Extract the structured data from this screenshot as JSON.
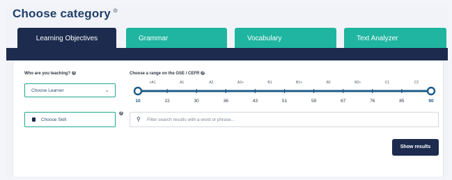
{
  "title": "Choose category",
  "tabs": [
    {
      "label": "Learning Objectives",
      "active": true
    },
    {
      "label": "Grammar",
      "active": false
    },
    {
      "label": "Vocabulary",
      "active": false
    },
    {
      "label": "Text Analyzer",
      "active": false
    }
  ],
  "learner": {
    "label": "Who are you teaching?",
    "select_value": "Choose Learner"
  },
  "range": {
    "label": "Choose a range on the GSE / CEFR",
    "cefr_labels": [
      "<A1",
      "A1",
      "A2",
      "A2+",
      "B1",
      "B1+",
      "B2",
      "B2+",
      "C1",
      "C2"
    ],
    "gse_values": [
      "10",
      "22",
      "30",
      "36",
      "43",
      "51",
      "59",
      "67",
      "76",
      "85",
      "90"
    ],
    "selected_min": 10,
    "selected_max": 90
  },
  "skill": {
    "label": "Choose Skill"
  },
  "search": {
    "placeholder": "Filter search results with a word or phrase..."
  },
  "show_results_label": "Show results",
  "colors": {
    "navy": "#1c2b4e",
    "teal": "#1fb5a0",
    "title": "#1f3f6a",
    "slider": "#1d5a86"
  }
}
